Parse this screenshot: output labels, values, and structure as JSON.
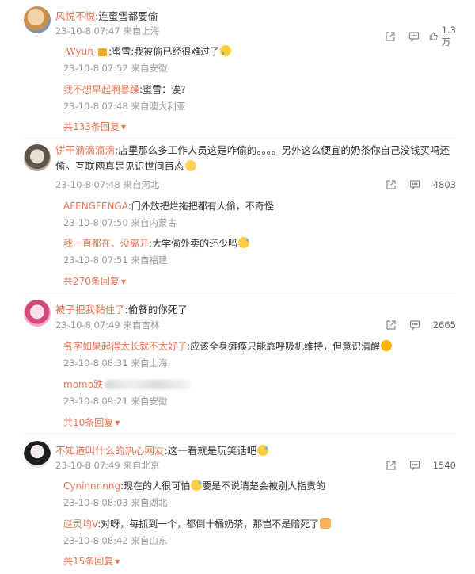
{
  "threads": [
    {
      "user": "风悦不悦",
      "sep": ":",
      "text": "连蜜雪都要偷",
      "time": "23-10-8 07:47 来自上海",
      "likes": "1.3万",
      "replies": [
        {
          "user": "-Wyun-",
          "user_badge": "crown-badge",
          "sep": ":",
          "text": "蜜雪:我被偷已经很难过了",
          "emoji": "cry-emoji",
          "time": "23-10-8 07:52 来自安徽"
        },
        {
          "user": "我不想早起啊暴躁",
          "sep": ":",
          "text": "蜜雪：诶?",
          "time": "23-10-8 07:48 来自澳大利亚"
        }
      ],
      "more": "共133条回复"
    },
    {
      "user": "饼干滴滴滴滴",
      "sep": ":",
      "text": "店里那么多工作人员这是咋偷的。。。。另外这么便宜的奶茶你自己没钱买吗还偷。互联网真是见识世间百态",
      "emoji": "think-emoji",
      "time": "23-10-8 07:48 来自河北",
      "likes": "4803",
      "replies": [
        {
          "user": "AFENGFENGA",
          "sep": ":",
          "text": "门外放把烂拖把都有人偷，不奇怪",
          "time": "23-10-8 07:50 来自内蒙古"
        },
        {
          "user": "我一直都在、没离开",
          "sep": ":",
          "text": "大学偷外卖的还少吗",
          "emoji": "sweat-emoji",
          "time": "23-10-8 07:51 来自福建"
        }
      ],
      "more": "共270条回复"
    },
    {
      "user": "被子把我黏住了",
      "sep": ":",
      "text": "偷餐的你死了",
      "time": "23-10-8 07:49 来自吉林",
      "likes": "2665",
      "replies": [
        {
          "user": "名字如果起得太长就不太好了",
          "sep": ":",
          "text": "应该全身瘫痪只能靠呼吸机维持，但意识清醒",
          "emoji": "money-emoji",
          "time": "23-10-8 08:31 来自上海"
        },
        {
          "user": "momo跌",
          "text": "",
          "time": "23-10-8 09:21 来自安徽"
        }
      ],
      "more": "共10条回复"
    },
    {
      "user": "不知道叫什么的热心网友",
      "sep": ":",
      "text": "这一看就是玩笑话吧",
      "emoji": "sweat-emoji",
      "time": "23-10-8 07:49 来自北京",
      "likes": "1540",
      "replies": [
        {
          "user": "Cyninnnnng",
          "sep": ":",
          "text": "现在的人很可怕",
          "text2": "要是不说清楚会被别人指责的",
          "emoji": "sweat-emoji",
          "time": "23-10-8 08:03 来自湖北"
        },
        {
          "user": "赵灵均V",
          "sep": ":",
          "text": "对呀，每抓到一个，都倒十桶奶茶，那岂不是赔死了",
          "emoji": "cat-emoji",
          "time": "23-10-8 08:42 来自山东"
        }
      ],
      "more": "共15条回复"
    }
  ],
  "colors": {
    "username": "#eb7350",
    "time": "#999999",
    "text": "#333333"
  }
}
